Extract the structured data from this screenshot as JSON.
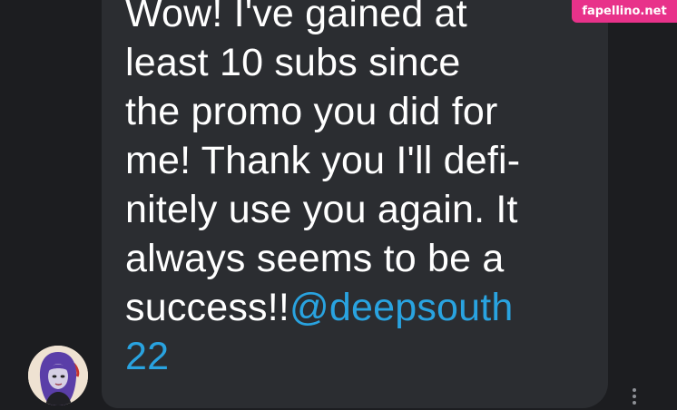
{
  "message": {
    "text": "Wow! I've gained at\nleast 10 subs since\nthe promo you did for\nme! Thank you I'll defi-\nnitely use you again. It\nalways seems to be a\nsuccess!!",
    "mention": "@deepsouth\n22",
    "text_color": "#ffffff",
    "mention_color": "#29a3e0",
    "bubble_color": "#2b2d31"
  },
  "watermark": {
    "text": "fapellino.net",
    "color": "#e8328a"
  },
  "avatar": {
    "icon": "user-avatar"
  },
  "more_button": {
    "icon": "more-vertical-icon"
  },
  "theme": {
    "background": "#1c1d20"
  }
}
